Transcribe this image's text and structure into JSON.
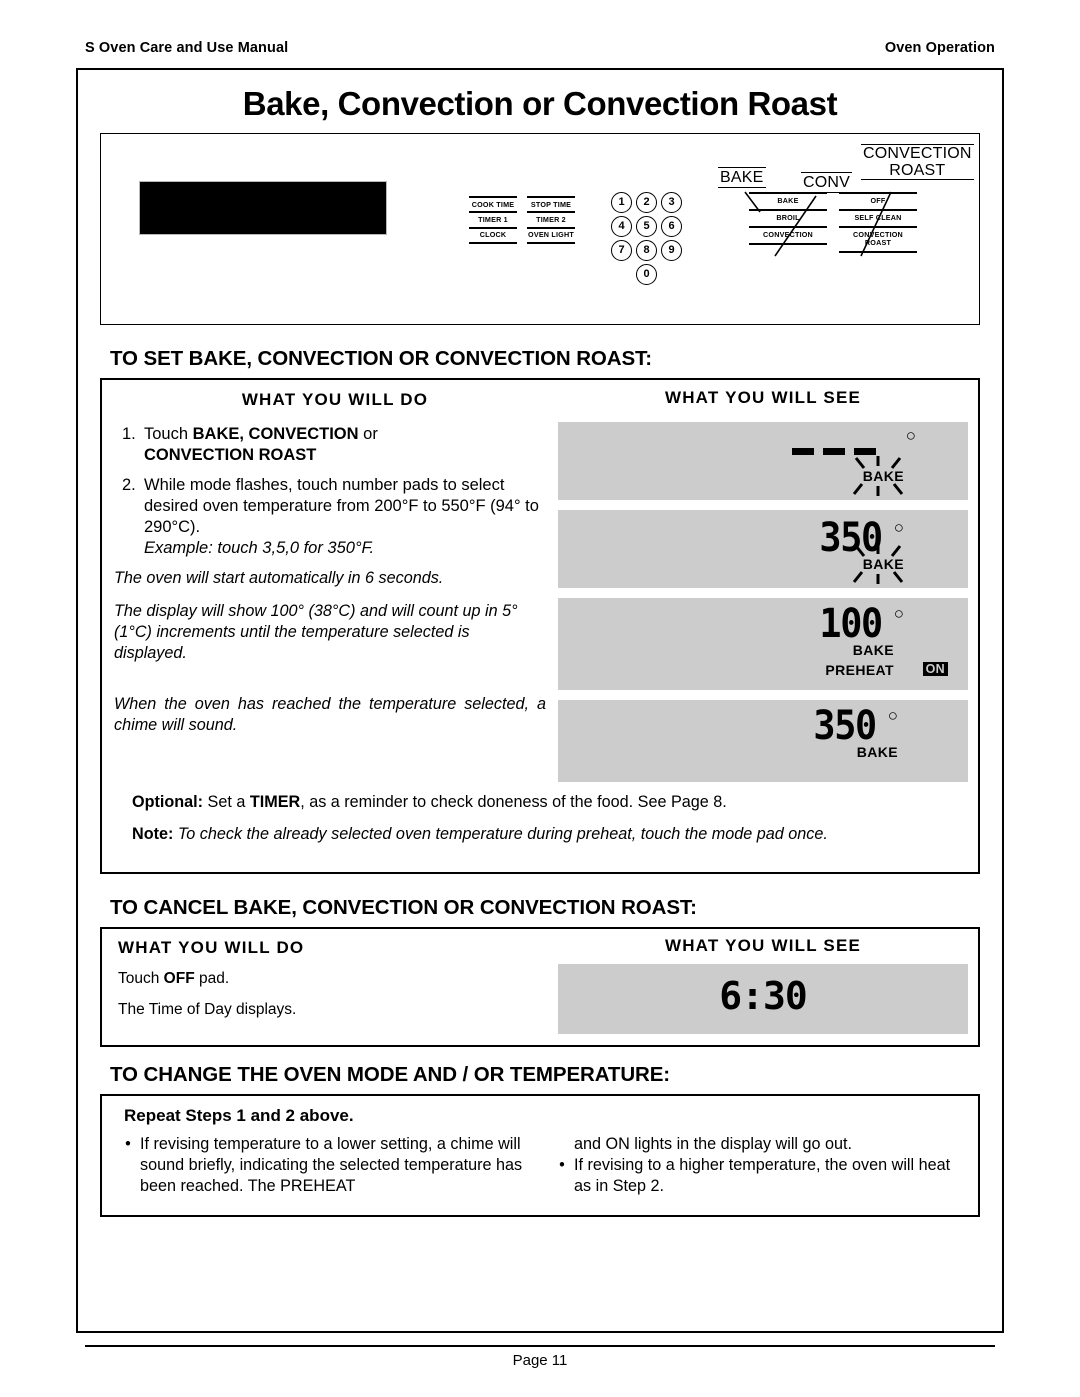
{
  "running_head": {
    "left": "S Oven Care and Use Manual",
    "right": "Oven Operation"
  },
  "title": "Bake, Convection or Convection Roast",
  "control_panel": {
    "function_pads": [
      [
        "COOK TIME",
        "STOP TIME"
      ],
      [
        "TIMER 1",
        "TIMER 2"
      ],
      [
        "CLOCK",
        "OVEN LIGHT"
      ]
    ],
    "keypad": [
      [
        "1",
        "2",
        "3"
      ],
      [
        "4",
        "5",
        "6"
      ],
      [
        "7",
        "8",
        "9"
      ],
      [
        "0"
      ]
    ],
    "mode_pads_left": [
      "BAKE",
      "BROIL",
      "CONVECTION"
    ],
    "mode_pads_right": [
      "OFF",
      "SELF CLEAN",
      "CONVECTION ROAST"
    ],
    "callouts": {
      "bake": "BAKE",
      "conv": "CONV",
      "convection_roast_line1": "CONVECTION",
      "convection_roast_line2": "ROAST"
    }
  },
  "set_section": {
    "heading": "TO SET BAKE, CONVECTION OR  CONVECTION ROAST:",
    "col_do_head": "WHAT  YOU  WILL  DO",
    "col_see_head": "WHAT  YOU  WILL SEE",
    "step1_num": "1.",
    "step1_a": "Touch ",
    "step1_b": "BAKE, CONVECTION",
    "step1_c": " or",
    "step1_d": "CONVECTION ROAST",
    "step2_num": "2.",
    "step2_text": "While mode flashes, touch number pads to select desired oven temperature from 200°F to 550°F (94° to 290°C).",
    "step2_example": "Example: touch 3,5,0 for 350°F.",
    "auto_start": "The oven will start automatically in 6 seconds.",
    "count_up": "The display will show 100° (38°C) and will count up in 5° (1°C) increments until the temperature selected is displayed.",
    "chime": "When the oven has reached the temperature selected, a chime will sound.",
    "optional_label": "Optional:",
    "optional_a": " Set a ",
    "optional_timer": "TIMER",
    "optional_b": ", as a reminder to check doneness of the food.  See Page 8.",
    "note_label": "Note:",
    "note_text": " To check the already selected oven temperature during preheat, touch the mode pad once.",
    "displays": [
      {
        "value": "— — —",
        "degree": "○",
        "mode": "BAKE",
        "flashing": true
      },
      {
        "value": "350",
        "degree": "○",
        "mode": "BAKE",
        "flashing": true
      },
      {
        "value": "100",
        "degree": "○",
        "mode": "BAKE",
        "preheat": "PREHEAT",
        "on_badge": "ON",
        "flashing": false
      },
      {
        "value": "350",
        "degree": "○",
        "mode": "BAKE",
        "flashing": false
      }
    ]
  },
  "cancel_section": {
    "heading": "TO CANCEL BAKE, CONVECTION OR  CONVECTION ROAST:",
    "col_do_head": "WHAT  YOU  WILL  DO",
    "col_see_head": "WHAT  YOU  WILL SEE",
    "line1_a": "Touch ",
    "line1_b": "OFF",
    "line1_c": " pad.",
    "line2": "The Time of Day displays.",
    "display_value": "6:30"
  },
  "change_section": {
    "heading": "TO CHANGE THE OVEN MODE  AND / OR  TEMPERATURE:",
    "repeat": "Repeat Steps 1 and 2 above.",
    "bullet1": "If revising temperature to a lower setting, a chime will sound briefly, indicating the selected temperature has been reached. The PREHEAT",
    "bullet1_cont": "and ON lights in the display will go out.",
    "bullet2": "If revising to a higher temperature, the oven will heat as in Step 2.",
    "bullet_glyph": "•"
  },
  "footer": "Page 11",
  "colors": {
    "lcd_background": "#cccccc",
    "ink": "#000000",
    "paper": "#ffffff"
  }
}
